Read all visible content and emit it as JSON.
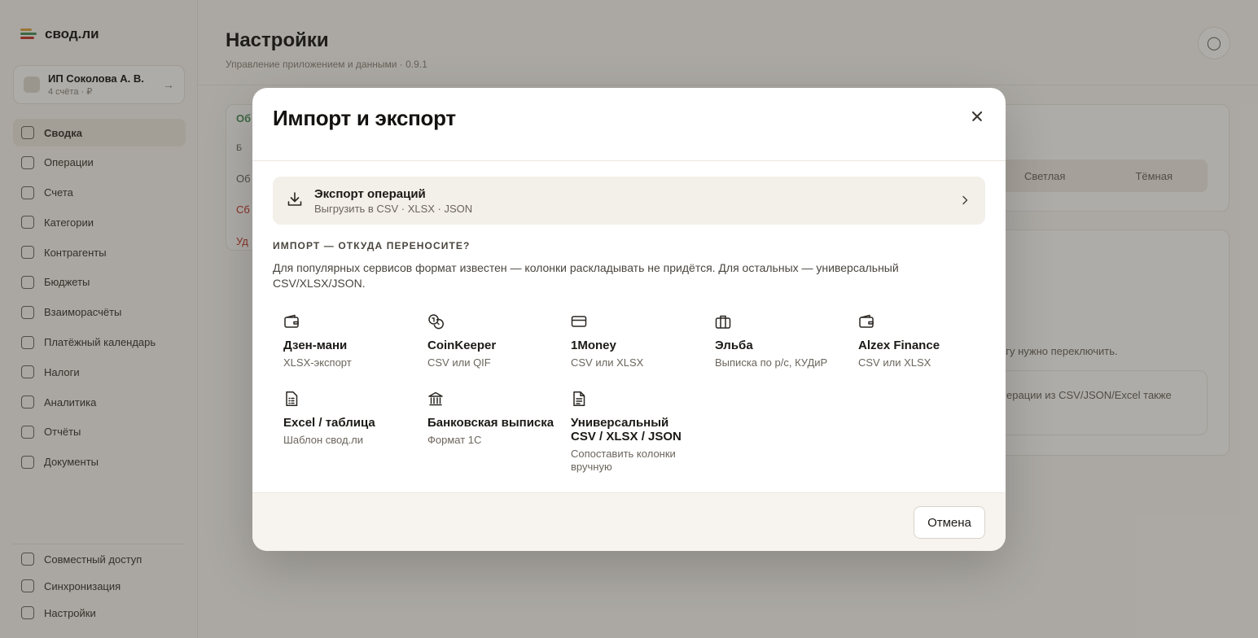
{
  "app": {
    "brand": "свод.ли",
    "brand_colors": [
      "#d9a441",
      "#4a8f5b",
      "#c0392b"
    ],
    "org": {
      "name": "ИП Соколова А. В.",
      "sub": "4 счёта · ₽"
    },
    "nav": [
      {
        "label": "Сводка",
        "icon": "home-icon",
        "active": true
      },
      {
        "label": "Операции",
        "icon": "list-icon"
      },
      {
        "label": "Счета",
        "icon": "wallet-icon"
      },
      {
        "label": "Категории",
        "icon": "tag-icon"
      },
      {
        "label": "Контрагенты",
        "icon": "users-icon"
      },
      {
        "label": "Бюджеты",
        "icon": "target-icon"
      },
      {
        "label": "Взаиморасчёты",
        "icon": "swap-icon"
      },
      {
        "label": "Платёжный календарь",
        "icon": "calendar-icon"
      },
      {
        "label": "Налоги",
        "icon": "receipt-icon"
      },
      {
        "label": "Аналитика",
        "icon": "pie-chart-icon"
      },
      {
        "label": "Отчёты",
        "icon": "report-icon"
      },
      {
        "label": "Документы",
        "icon": "folder-icon"
      }
    ],
    "nav_bottom": [
      {
        "label": "Совместный доступ",
        "icon": "share-icon"
      },
      {
        "label": "Синхронизация",
        "icon": "sync-icon"
      },
      {
        "label": "Настройки",
        "icon": "gear-icon"
      }
    ],
    "page_title": "Настройки",
    "page_sub": "Управление приложением и данными · 0.9.1",
    "bg": {
      "card_title": "Об",
      "line1": "Б",
      "line2": "Об",
      "line3": "Сб",
      "line4": "Уд",
      "theme_light": "Светлая",
      "theme_dark": "Тёмная",
      "hint1": "агу нужно переключить.",
      "hint2": "ерации из CSV/JSON/Excel также"
    }
  },
  "modal": {
    "title": "Импорт и экспорт",
    "export": {
      "title": "Экспорт операций",
      "subtitle": "Выгрузить в CSV · XLSX · JSON"
    },
    "import_label": "ИМПОРТ — ОТКУДА ПЕРЕНОСИТЕ?",
    "import_desc": "Для популярных сервисов формат известен — колонки раскладывать не придётся. Для остальных — универсальный CSV/XLSX/JSON.",
    "sources": [
      {
        "title": "Дзен-мани",
        "subtitle": "XLSX-экспорт",
        "icon": "wallet-icon"
      },
      {
        "title": "CoinKeeper",
        "subtitle": "CSV или QIF",
        "icon": "coins-icon"
      },
      {
        "title": "1Money",
        "subtitle": "CSV или XLSX",
        "icon": "credit-card-icon"
      },
      {
        "title": "Эльба",
        "subtitle": "Выписка по р/с, КУДиР",
        "icon": "briefcase-icon"
      },
      {
        "title": "Alzex Finance",
        "subtitle": "CSV или XLSX",
        "icon": "wallet-icon"
      },
      {
        "title": "Excel / таблица",
        "subtitle": "Шаблон свод.ли",
        "icon": "spreadsheet-icon"
      },
      {
        "title": "Банковская выписка",
        "subtitle": "Формат 1С",
        "icon": "bank-icon"
      },
      {
        "title": "Универсальный CSV / XLSX / JSON",
        "subtitle": "Сопоставить колонки вручную",
        "icon": "document-icon"
      }
    ],
    "cancel_label": "Отмена"
  }
}
